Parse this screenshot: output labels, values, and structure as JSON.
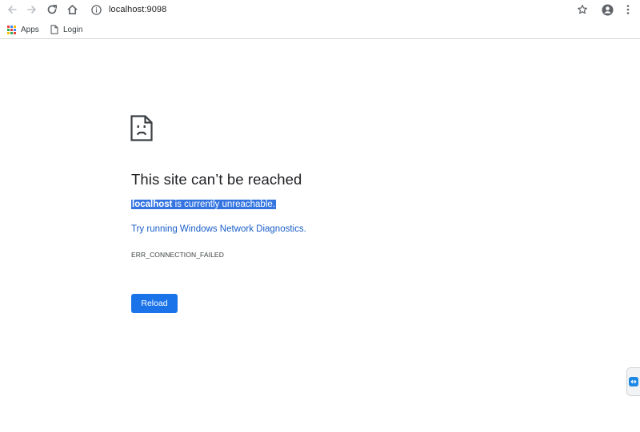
{
  "browser": {
    "url": "localhost:9098",
    "nav_icons": [
      "back-arrow-icon",
      "forward-arrow-icon",
      "reload-icon",
      "home-icon",
      "info-icon"
    ],
    "right_icons": [
      "star-icon",
      "account-icon",
      "menu-kebab-icon"
    ]
  },
  "bookmarks": {
    "apps_label": "Apps",
    "login_label": "Login"
  },
  "error_page": {
    "title": "This site can’t be reached",
    "host": "localhost",
    "description_rest": " is currently unreachable.",
    "diagnostics_link": "Try running Windows Network Diagnostics.",
    "error_code": "ERR_CONNECTION_FAILED",
    "reload_label": "Reload"
  },
  "colors": {
    "accent": "#1a73e8",
    "link": "#1a5fc8",
    "selection": "#3374e1",
    "text": "#202124"
  }
}
